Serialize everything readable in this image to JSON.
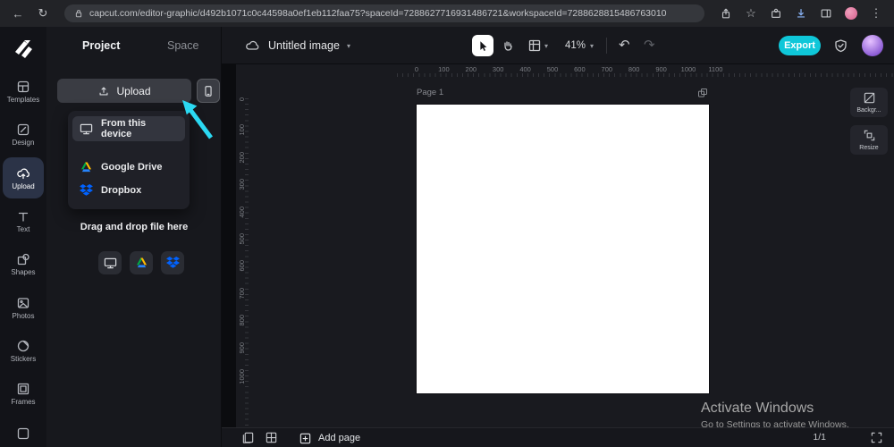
{
  "browser": {
    "url": "capcut.com/editor-graphic/d492b1071c0c44598a0ef1eb112faa75?spaceId=7288627716931486721&workspaceId=7288628815486763010"
  },
  "sidebar": {
    "items": [
      {
        "label": "Templates"
      },
      {
        "label": "Design"
      },
      {
        "label": "Upload"
      },
      {
        "label": "Text"
      },
      {
        "label": "Shapes"
      },
      {
        "label": "Photos"
      },
      {
        "label": "Stickers"
      },
      {
        "label": "Frames"
      }
    ]
  },
  "panel": {
    "tab_project": "Project",
    "tab_space": "Space",
    "upload_button": "Upload",
    "menu_items": [
      {
        "label": "From this device"
      },
      {
        "label": "Google Drive"
      },
      {
        "label": "Dropbox"
      }
    ],
    "dropzone": "Drag and drop file here"
  },
  "toolbar": {
    "title": "Untitled image",
    "zoom": "41%",
    "export": "Export",
    "undo": "↶",
    "redo": "↷"
  },
  "canvas": {
    "page_label": "Page 1",
    "h_ruler": [
      "0",
      "100",
      "200",
      "300",
      "400",
      "500",
      "600",
      "700",
      "800",
      "900",
      "1000",
      "1100"
    ],
    "v_ruler": [
      "0",
      "100",
      "200",
      "300",
      "400",
      "500",
      "600",
      "700",
      "800",
      "900",
      "1000"
    ]
  },
  "side_tools": [
    {
      "label": "Backgr..."
    },
    {
      "label": "Resize"
    }
  ],
  "bottom": {
    "add_page": "Add page",
    "page_indicator": "1/1"
  },
  "watermark": {
    "line1": "Activate Windows",
    "line2": "Go to Settings to activate Windows."
  },
  "colors": {
    "accent": "#0fc7d9",
    "arrow": "#2bd9f2"
  }
}
